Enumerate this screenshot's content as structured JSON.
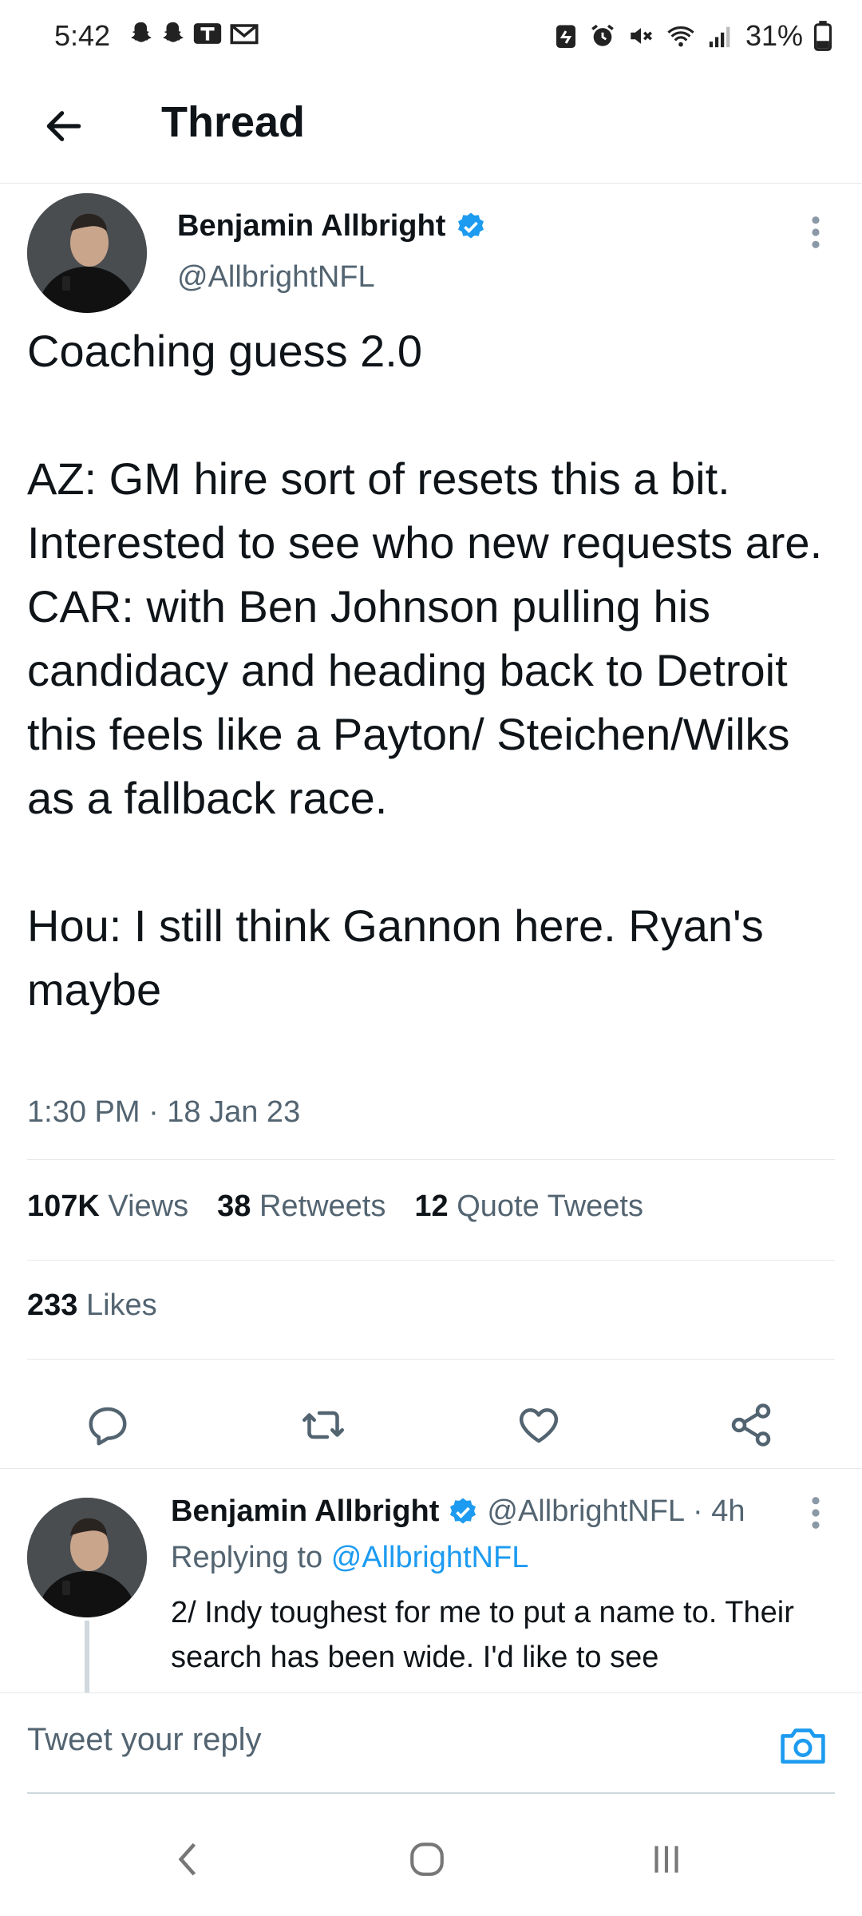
{
  "status_bar": {
    "time": "5:42",
    "battery": "31%",
    "icons": [
      "snapchat-icon",
      "snapchat-icon",
      "teams-icon",
      "gmail-icon",
      "battery-saver-icon",
      "alarm-icon",
      "mute-icon",
      "wifi-icon",
      "signal-icon",
      "battery-icon"
    ]
  },
  "header": {
    "title": "Thread"
  },
  "main_tweet": {
    "author_name": "Benjamin Allbright",
    "author_handle": "@AllbrightNFL",
    "text": "Coaching guess 2.0\n\nAZ: GM hire sort of resets this a bit. Interested to see who new requests are.\nCAR: with Ben Johnson pulling his candidacy and heading back to Detroit this feels like a Payton/ Steichen/Wilks as a fallback race.\n\nHou: I still think Gannon here. Ryan's maybe",
    "timestamp": "1:30 PM · 18 Jan 23",
    "views_count": "107K",
    "views_label": "Views",
    "retweets_count": "38",
    "retweets_label": "Retweets",
    "quotes_count": "12",
    "quotes_label": "Quote Tweets",
    "likes_count": "233",
    "likes_label": "Likes"
  },
  "actions": [
    "reply-icon",
    "retweet-icon",
    "like-icon",
    "share-icon"
  ],
  "reply": {
    "author_name": "Benjamin Allbright",
    "author_handle": "@AllbrightNFL",
    "age": "· 4h",
    "replying_prefix": "Replying to",
    "replying_to": "@AllbrightNFL",
    "text": "2/ Indy toughest for me to put a name to. Their search has been wide. I'd like to see"
  },
  "composer": {
    "placeholder": "Tweet your reply"
  },
  "colors": {
    "accent": "#1d9bf0",
    "secondary_text": "#536471",
    "primary_text": "#0f1419"
  }
}
